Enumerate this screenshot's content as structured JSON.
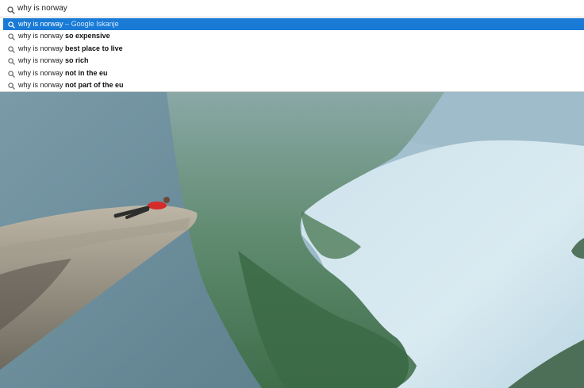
{
  "omnibox": {
    "query": "why is norway",
    "icon": "search-icon"
  },
  "suggestions": [
    {
      "query": "why is norway",
      "completion": "",
      "separator": "–",
      "provider": "Google Iskanje",
      "selected": true
    },
    {
      "query": "why is norway",
      "completion": "so expensive",
      "selected": false
    },
    {
      "query": "why is norway",
      "completion": "best place to live",
      "selected": false
    },
    {
      "query": "why is norway",
      "completion": "so rich",
      "selected": false
    },
    {
      "query": "why is norway",
      "completion": "not in the eu",
      "selected": false
    },
    {
      "query": "why is norway",
      "completion": "not part of the eu",
      "selected": false
    }
  ],
  "colors": {
    "selection": "#1a7bd6",
    "fjord_water": "#d8e9ef",
    "mountain": "#6f8f86",
    "climber_shirt": "#d62b2b"
  }
}
